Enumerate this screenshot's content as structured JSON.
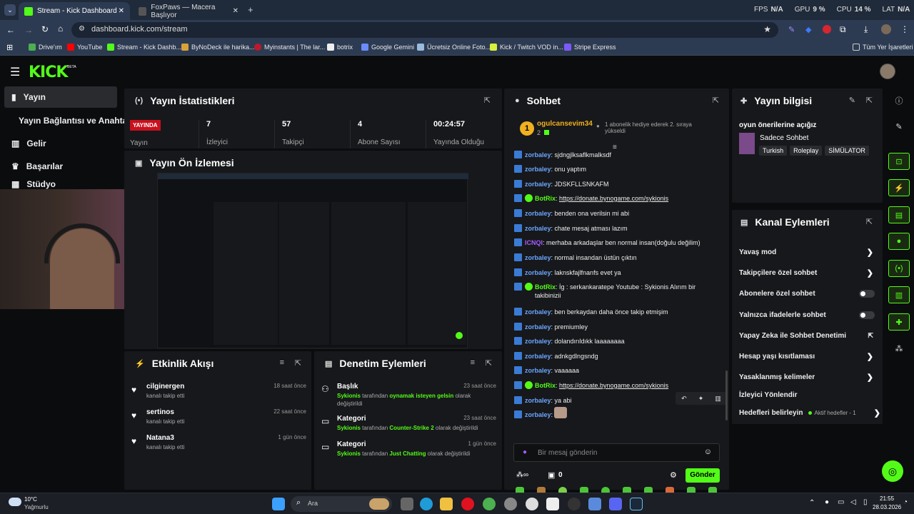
{
  "browser": {
    "tabs": [
      {
        "title": "Stream - Kick Dashboard",
        "active": true
      },
      {
        "title": "FoxPaws — Macera Başlıyor",
        "active": false
      }
    ],
    "perf": {
      "fps_label": "FPS",
      "fps_value": "N/A",
      "gpu_label": "GPU",
      "gpu_value": "9 %",
      "cpu_label": "CPU",
      "cpu_value": "14 %",
      "lat_label": "LAT",
      "lat_value": "N/A"
    },
    "url": "dashboard.kick.com/stream",
    "bookmarks": [
      "Drive'ım",
      "YouTube",
      "Stream - Kick Dashb...",
      "ByNoDeck ile harika...",
      "Myinstants | The lar...",
      "botrix",
      "Google Gemini",
      "Ücretsiz Online Foto...",
      "Kick / Twitch VOD in...",
      "Stripe Express"
    ],
    "bookmarks_all": "Tüm Yer İşaretleri"
  },
  "kick": {
    "logo": "KICK",
    "logo_beta": "BETA",
    "sidebar": [
      "Yayın",
      "Yayın Bağlantısı ve Anahtarı",
      "Gelir",
      "Başarılar",
      "Stüdyo"
    ],
    "stats": {
      "title": "Yayın İstatistikleri",
      "live_badge": "YAYINDA",
      "live_label": "Yayın",
      "items": [
        {
          "value": "7",
          "label": "İzleyici"
        },
        {
          "value": "57",
          "label": "Takipçi"
        },
        {
          "value": "4",
          "label": "Abone Sayısı"
        },
        {
          "value": "00:24:57",
          "label": "Yayında Olduğu"
        }
      ]
    },
    "preview": {
      "title": "Yayın Ön İzlemesi"
    },
    "activity": {
      "title": "Etkinlik Akışı",
      "items": [
        {
          "name": "cilginergen",
          "sub": "kanalı takip etti",
          "time": "18 saat önce"
        },
        {
          "name": "sertinos",
          "sub": "kanalı takip etti",
          "time": "22 saat önce"
        },
        {
          "name": "Natana3",
          "sub": "kanalı takip etti",
          "time": "1 gün önce"
        }
      ]
    },
    "moderation": {
      "title": "Denetim Eylemleri",
      "items": [
        {
          "title": "Başlık",
          "time": "23 saat önce",
          "actor": "Sykionis",
          "mid": "tarafından",
          "value": "oynamak isteyen gelsin",
          "end": "olarak değiştirildi"
        },
        {
          "title": "Kategori",
          "time": "23 saat önce",
          "actor": "Sykionis",
          "mid": "tarafından",
          "value": "Counter-Strike 2",
          "end": "olarak değiştirildi"
        },
        {
          "title": "Kategori",
          "time": "1 gün önce",
          "actor": "Sykionis",
          "mid": "tarafından",
          "value": "Just Chatting",
          "end": "olarak değiştirildi"
        }
      ]
    },
    "chat": {
      "title": "Sohbet",
      "pinned_user": "ogulcansevim34",
      "pinned_rank": "1",
      "pinned_count": "2",
      "pinned_note": "1 abonelik hediye ederek 2. sıraya yükseldi",
      "messages": [
        {
          "user": "zorbaley",
          "text": "sjdngjlksaflkmalksdf",
          "bot": false
        },
        {
          "user": "zorbaley",
          "text": "onu yaptım",
          "bot": false
        },
        {
          "user": "zorbaley",
          "text": "JDSKFLLSNKAFM",
          "bot": false
        },
        {
          "user": "BotRix",
          "text": "https://donate.bynogame.com/sykionis",
          "bot": true
        },
        {
          "user": "zorbaley",
          "text": "benden ona verilsin mi abi",
          "bot": false
        },
        {
          "user": "zorbaley",
          "text": "chate mesaj atması lazım",
          "bot": false
        },
        {
          "user": "ICNQI",
          "text": "merhaba arkadaşlar ben normal insan(doğulu değilim)",
          "bot": false
        },
        {
          "user": "zorbaley",
          "text": "normal insandan üstün çıktın",
          "bot": false
        },
        {
          "user": "zorbaley",
          "text": "laknskfajlfnanfs evet ya",
          "bot": false
        },
        {
          "user": "BotRix",
          "text": "İg : serkankaratepe Youtube : Sykionis Alırım bir takibinizii",
          "bot": true
        },
        {
          "user": "zorbaley",
          "text": "ben berkaydan daha önce takip etmişim",
          "bot": false
        },
        {
          "user": "zorbaley",
          "text": "premiumley",
          "bot": false
        },
        {
          "user": "zorbaley",
          "text": "dolandırıldıkk laaaaaaaa",
          "bot": false
        },
        {
          "user": "zorbaley",
          "text": "adnkgdlngsndg",
          "bot": false
        },
        {
          "user": "zorbaley",
          "text": "vaaaaaa",
          "bot": false
        },
        {
          "user": "BotRix",
          "text": "https://donate.bynogame.com/sykionis",
          "bot": true
        },
        {
          "user": "zorbaley",
          "text": "ya abi",
          "bot": false
        },
        {
          "user": "zorbaley",
          "text": "",
          "bot": false
        }
      ],
      "input_placeholder": "Bir mesaj gönderin",
      "points_count": "0",
      "send_label": "Gönder"
    },
    "stream_info": {
      "title": "Yayın bilgisi",
      "stream_title": "oyun önerilerine açığız",
      "category": "Sadece Sohbet",
      "tags": [
        "Turkish",
        "Roleplay",
        "SİMÜLATOR"
      ]
    },
    "channel_actions": {
      "title": "Kanal Eylemleri",
      "items": [
        {
          "label": "Yavaş mod",
          "control": "chevron"
        },
        {
          "label": "Takipçilere özel sohbet",
          "control": "chevron"
        },
        {
          "label": "Abonelere özel sohbet",
          "control": "toggle"
        },
        {
          "label": "Yalnızca ifadelerle sohbet",
          "control": "toggle"
        },
        {
          "label": "Yapay Zeka ile Sohbet Denetimi",
          "control": "external"
        },
        {
          "label": "Hesap yaşı kısıtlaması",
          "control": "chevron"
        },
        {
          "label": "Yasaklanmış kelimeler",
          "control": "chevron"
        },
        {
          "label": "İzleyici Yönlendir",
          "control": "none"
        },
        {
          "label": "Hedefleri belirleyin",
          "control": "chevron",
          "extra": "Aktif hedefler - 1"
        }
      ]
    }
  },
  "taskbar": {
    "weather_temp": "10°C",
    "weather_text": "Yağmurlu",
    "search": "Ara",
    "time": "21:55",
    "date": "28.03.2026"
  },
  "colors": {
    "accent": "#53fc18",
    "panel": "#17181b",
    "bg": "#0b0c0e",
    "live": "#e8132b",
    "user": "#6aa5ff"
  }
}
